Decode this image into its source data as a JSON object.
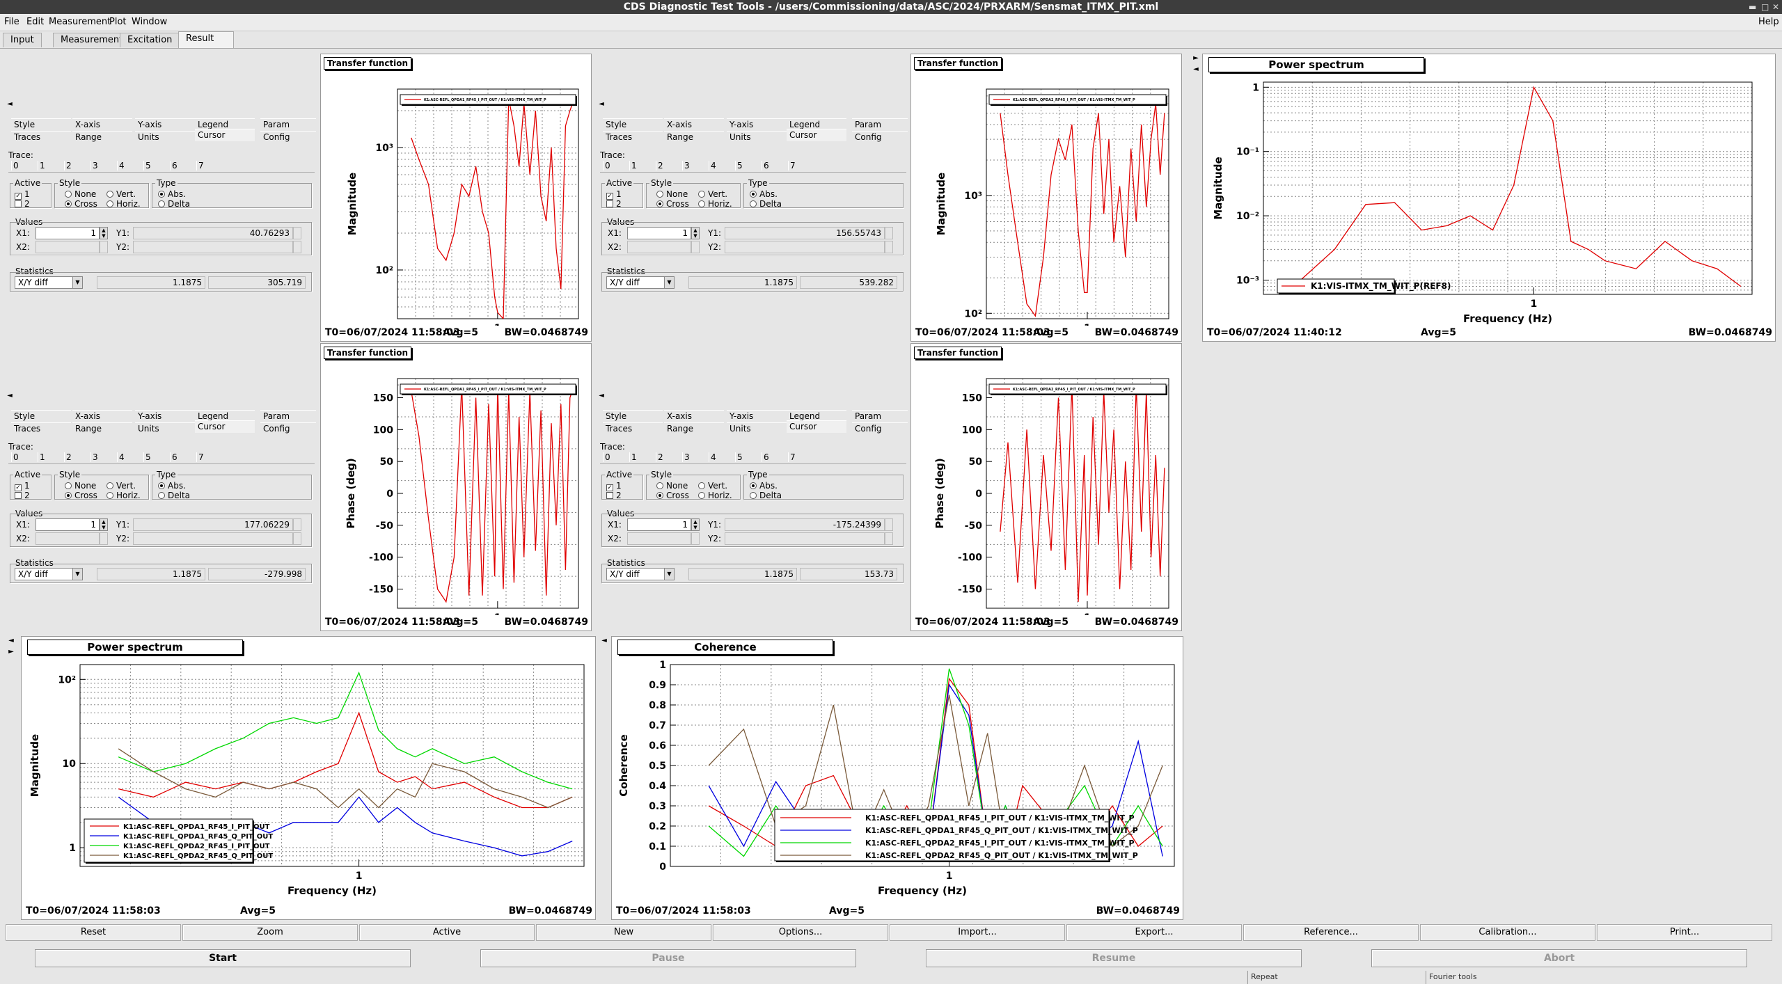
{
  "window": {
    "title": "CDS Diagnostic Test Tools - /users/Commissioning/data/ASC/2024/PRXARM/Sensmat_ITMX_PIT.xml",
    "help": "Help"
  },
  "menu": [
    "File",
    "Edit",
    "Measurement",
    "Plot",
    "Window"
  ],
  "tabs": [
    "Input",
    "Measurement",
    "Excitation",
    "Result"
  ],
  "options": {
    "row1": [
      "Style",
      "X-axis",
      "Y-axis",
      "Legend",
      "Param"
    ],
    "row2": [
      "Traces",
      "Range",
      "Units",
      "Cursor",
      "Config"
    ],
    "trace_label": "Trace:",
    "trace_nums": [
      "0",
      "1",
      "2",
      "3",
      "4",
      "5",
      "6",
      "7"
    ],
    "active_label": "Active",
    "style_label": "Style",
    "type_label": "Type",
    "none": "None",
    "cross": "Cross",
    "vert": "Vert.",
    "horiz": "Horiz.",
    "abs": "Abs.",
    "delta": "Delta",
    "values_label": "Values",
    "x1": "X1:",
    "y1": "Y1:",
    "x2": "X2:",
    "y2": "Y2:",
    "stats_label": "Statistics",
    "one": "1",
    "two": "2"
  },
  "controls": [
    {
      "x1": "1",
      "y1": "40.76293",
      "stat": "X/Y diff",
      "v1": "1.1875",
      "v2": "305.719"
    },
    {
      "x1": "1",
      "y1": "156.55743",
      "stat": "X/Y diff",
      "v1": "1.1875",
      "v2": "539.282"
    },
    {
      "x1": "1",
      "y1": "177.06229",
      "stat": "X/Y diff",
      "v1": "1.1875",
      "v2": "-279.998"
    },
    {
      "x1": "1",
      "y1": "-175.24399",
      "stat": "X/Y diff",
      "v1": "1.1875",
      "v2": "153.73"
    }
  ],
  "panels": [
    {
      "title": "Transfer function",
      "xlabel": "Frequency (Hz)",
      "ylabel": "Magnitude",
      "legend": "K1:ASC-REFL_QPDA1_RF45_I_PIT_OUT / K1:VIS-ITMX_TM_WIT_P",
      "t0": "T0=06/07/2024 11:58:03",
      "avg": "Avg=5",
      "bw": "BW=0.0468749",
      "ticks": [
        "10³",
        "10²"
      ],
      "xtick": "1"
    },
    {
      "title": "Transfer function",
      "xlabel": "Frequency (Hz)",
      "ylabel": "Magnitude",
      "legend": "K1:ASC-REFL_QPDA2_RF45_I_PIT_OUT / K1:VIS-ITMX_TM_WIT_P",
      "t0": "T0=06/07/2024 11:58:03",
      "avg": "Avg=5",
      "bw": "BW=0.0468749",
      "ticks": [
        "10³",
        "10²"
      ],
      "xtick": "1"
    },
    {
      "title": "Power spectrum",
      "xlabel": "Frequency (Hz)",
      "ylabel": "Magnitude",
      "legend": "K1:VIS-ITMX_TM_WIT_P(REF8)",
      "t0": "T0=06/07/2024 11:40:12",
      "avg": "Avg=5",
      "bw": "BW=0.0468749",
      "ticks": [
        "1",
        "10⁻¹",
        "10⁻²",
        "10⁻³"
      ],
      "xtick": "1"
    },
    {
      "title": "Transfer function",
      "xlabel": "Frequency (Hz)",
      "ylabel": "Phase (deg)",
      "legend": "K1:ASC-REFL_QPDA1_RF45_I_PIT_OUT / K1:VIS-ITMX_TM_WIT_P",
      "t0": "T0=06/07/2024 11:58:03",
      "avg": "Avg=5",
      "bw": "BW=0.0468749",
      "ticks": [
        "150",
        "100",
        "50",
        "0",
        "-50",
        "-100",
        "-150"
      ],
      "xtick": "1"
    },
    {
      "title": "Transfer function",
      "xlabel": "Frequency (Hz)",
      "ylabel": "Phase (deg)",
      "legend": "K1:ASC-REFL_QPDA2_RF45_I_PIT_OUT / K1:VIS-ITMX_TM_WIT_P",
      "t0": "T0=06/07/2024 11:58:03",
      "avg": "Avg=5",
      "bw": "BW=0.0468749",
      "ticks": [
        "150",
        "100",
        "50",
        "0",
        "-50",
        "-100",
        "-150"
      ],
      "xtick": "1"
    },
    {
      "title": "Power spectrum",
      "xlabel": "Frequency (Hz)",
      "ylabel": "Magnitude",
      "legend": "",
      "t0": "T0=06/07/2024 11:58:03",
      "avg": "Avg=5",
      "bw": "BW=0.0468749",
      "ticks": [
        "10²",
        "10",
        "1"
      ],
      "xtick": "1"
    },
    {
      "title": "Coherence",
      "xlabel": "Frequency (Hz)",
      "ylabel": "Coherence",
      "legend": "",
      "t0": "T0=06/07/2024 11:58:03",
      "avg": "Avg=5",
      "bw": "BW=0.0468749",
      "ticks": [
        "1",
        "0.9",
        "0.8",
        "0.7",
        "0.6",
        "0.5",
        "0.4",
        "0.3",
        "0.2",
        "0.1",
        "0"
      ],
      "xtick": "1"
    }
  ],
  "ps_legend": [
    "K1:ASC-REFL_QPDA1_RF45_I_PIT_OUT",
    "K1:ASC-REFL_QPDA1_RF45_Q_PIT_OUT",
    "K1:ASC-REFL_QPDA2_RF45_I_PIT_OUT",
    "K1:ASC-REFL_QPDA2_RF45_Q_PIT_OUT"
  ],
  "coh_legend": [
    "K1:ASC-REFL_QPDA1_RF45_I_PIT_OUT / K1:VIS-ITMX_TM_WIT_P",
    "K1:ASC-REFL_QPDA1_RF45_Q_PIT_OUT / K1:VIS-ITMX_TM_WIT_P",
    "K1:ASC-REFL_QPDA2_RF45_I_PIT_OUT / K1:VIS-ITMX_TM_WIT_P",
    "K1:ASC-REFL_QPDA2_RF45_Q_PIT_OUT / K1:VIS-ITMX_TM_WIT_P"
  ],
  "series_colors": {
    "s1": "#e00000",
    "s2": "#0000e0",
    "s3": "#00d800",
    "s4": "#7a5a3a"
  },
  "chart_data": [
    {
      "type": "line",
      "title": "Transfer function",
      "xlabel": "Frequency (Hz)",
      "ylabel": "Magnitude",
      "log_y": true,
      "ylim": [
        40,
        3000
      ],
      "x": [
        0.55,
        0.58,
        0.62,
        0.66,
        0.7,
        0.74,
        0.78,
        0.82,
        0.86,
        0.9,
        0.94,
        0.98,
        1.0,
        1.04,
        1.08,
        1.12,
        1.16,
        1.2,
        1.25,
        1.3,
        1.35,
        1.4,
        1.45,
        1.5,
        1.55,
        1.6,
        1.65,
        1.7
      ],
      "series": [
        {
          "name": "K1:ASC-REFL_QPDA1_RF45_I_PIT_OUT / K1:VIS-ITMX_TM_WIT_P",
          "values": [
            1200,
            800,
            500,
            150,
            120,
            200,
            500,
            400,
            700,
            300,
            200,
            60,
            45,
            40,
            2500,
            1500,
            700,
            2300,
            600,
            2000,
            400,
            250,
            1000,
            150,
            70,
            1500,
            2000,
            2500
          ]
        }
      ]
    },
    {
      "type": "line",
      "title": "Transfer function",
      "xlabel": "Frequency (Hz)",
      "ylabel": "Magnitude",
      "log_y": true,
      "ylim": [
        90,
        8000
      ],
      "x": [
        0.55,
        0.58,
        0.62,
        0.66,
        0.7,
        0.74,
        0.78,
        0.82,
        0.86,
        0.9,
        0.94,
        0.98,
        1.0,
        1.04,
        1.08,
        1.12,
        1.16,
        1.2,
        1.25,
        1.3,
        1.35,
        1.4,
        1.45,
        1.5,
        1.55,
        1.6,
        1.65,
        1.7
      ],
      "series": [
        {
          "name": "K1:ASC-REFL_QPDA2_RF45_I_PIT_OUT / K1:VIS-ITMX_TM_WIT_P",
          "values": [
            5000,
            1500,
            400,
            120,
            95,
            300,
            1500,
            3000,
            2000,
            4000,
            500,
            150,
            150,
            2500,
            5000,
            700,
            3000,
            400,
            1200,
            300,
            2500,
            600,
            4000,
            800,
            3000,
            6000,
            1500,
            5000
          ]
        }
      ]
    },
    {
      "type": "line",
      "title": "Power spectrum",
      "xlabel": "Frequency (Hz)",
      "ylabel": "Magnitude",
      "log_y": true,
      "ylim": [
        0.0006,
        1.2
      ],
      "x": [
        0.55,
        0.6,
        0.65,
        0.7,
        0.75,
        0.8,
        0.85,
        0.9,
        0.95,
        1.0,
        1.05,
        1.1,
        1.15,
        1.2,
        1.3,
        1.4,
        1.5,
        1.6,
        1.7
      ],
      "series": [
        {
          "name": "K1:VIS-ITMX_TM_WIT_P(REF8)",
          "values": [
            0.001,
            0.003,
            0.015,
            0.016,
            0.006,
            0.007,
            0.01,
            0.006,
            0.03,
            1.0,
            0.3,
            0.004,
            0.003,
            0.002,
            0.0015,
            0.004,
            0.002,
            0.0015,
            0.0008
          ]
        }
      ]
    },
    {
      "type": "line",
      "title": "Transfer function",
      "xlabel": "Frequency (Hz)",
      "ylabel": "Phase (deg)",
      "ylim": [
        -180,
        180
      ],
      "x": [
        0.55,
        0.58,
        0.62,
        0.66,
        0.7,
        0.74,
        0.78,
        0.82,
        0.86,
        0.9,
        0.94,
        0.98,
        1.0,
        1.04,
        1.08,
        1.12,
        1.16,
        1.2,
        1.25,
        1.3,
        1.35,
        1.4,
        1.45,
        1.5,
        1.55,
        1.6,
        1.65,
        1.7
      ],
      "series": [
        {
          "name": "K1:ASC-REFL_QPDA1_RF45_I_PIT_OUT / K1:VIS-ITMX_TM_WIT_P",
          "values": [
            160,
            90,
            -40,
            -150,
            -170,
            -100,
            170,
            -160,
            150,
            -160,
            140,
            -130,
            170,
            -150,
            160,
            -140,
            120,
            -100,
            160,
            -90,
            130,
            -160,
            110,
            -50,
            140,
            -120,
            150,
            170
          ]
        }
      ]
    },
    {
      "type": "line",
      "title": "Transfer function",
      "xlabel": "Frequency (Hz)",
      "ylabel": "Phase (deg)",
      "ylim": [
        -180,
        180
      ],
      "x": [
        0.55,
        0.58,
        0.62,
        0.66,
        0.7,
        0.74,
        0.78,
        0.82,
        0.86,
        0.9,
        0.94,
        0.98,
        1.0,
        1.04,
        1.08,
        1.12,
        1.16,
        1.2,
        1.25,
        1.3,
        1.35,
        1.4,
        1.45,
        1.5,
        1.55,
        1.6,
        1.65,
        1.7
      ],
      "series": [
        {
          "name": "K1:ASC-REFL_QPDA2_RF45_I_PIT_OUT / K1:VIS-ITMX_TM_WIT_P",
          "values": [
            -60,
            80,
            -140,
            100,
            -150,
            60,
            -90,
            150,
            -120,
            170,
            -170,
            60,
            -160,
            120,
            -80,
            160,
            -30,
            100,
            -150,
            50,
            -120,
            170,
            -60,
            160,
            -100,
            60,
            -130,
            40
          ]
        }
      ]
    },
    {
      "type": "line",
      "title": "Power spectrum",
      "xlabel": "Frequency (Hz)",
      "ylabel": "Magnitude",
      "log_y": true,
      "ylim": [
        0.6,
        150
      ],
      "x": [
        0.55,
        0.6,
        0.65,
        0.7,
        0.75,
        0.8,
        0.85,
        0.9,
        0.95,
        1.0,
        1.05,
        1.1,
        1.15,
        1.2,
        1.3,
        1.4,
        1.5,
        1.6,
        1.7
      ],
      "series": [
        {
          "name": "K1:ASC-REFL_QPDA1_RF45_I_PIT_OUT",
          "values": [
            5,
            4,
            6,
            5,
            6,
            5,
            6,
            8,
            10,
            40,
            8,
            6,
            7,
            5,
            6,
            4,
            3,
            3,
            4
          ]
        },
        {
          "name": "K1:ASC-REFL_QPDA1_RF45_Q_PIT_OUT",
          "values": [
            4,
            2,
            2,
            1.5,
            2,
            1.5,
            2,
            2,
            2,
            4,
            2,
            3,
            2,
            1.5,
            1.2,
            1,
            0.8,
            0.9,
            1.2
          ]
        },
        {
          "name": "K1:ASC-REFL_QPDA2_RF45_I_PIT_OUT",
          "values": [
            12,
            8,
            10,
            15,
            20,
            30,
            35,
            30,
            35,
            120,
            25,
            15,
            12,
            15,
            10,
            12,
            8,
            6,
            5
          ]
        },
        {
          "name": "K1:ASC-REFL_QPDA2_RF45_Q_PIT_OUT",
          "values": [
            15,
            8,
            5,
            4,
            6,
            5,
            6,
            5,
            3,
            5,
            3,
            5,
            4,
            10,
            8,
            5,
            4,
            3,
            4
          ]
        }
      ]
    },
    {
      "type": "line",
      "title": "Coherence",
      "xlabel": "Frequency (Hz)",
      "ylabel": "Coherence",
      "ylim": [
        0,
        1
      ],
      "x": [
        0.55,
        0.6,
        0.65,
        0.7,
        0.75,
        0.8,
        0.85,
        0.9,
        0.95,
        1.0,
        1.05,
        1.1,
        1.15,
        1.2,
        1.3,
        1.4,
        1.5,
        1.6,
        1.7
      ],
      "series": [
        {
          "name": "K1:ASC-REFL_QPDA1_RF45_I_PIT_OUT / K1:VIS-ITMX_TM_WIT_P",
          "values": [
            0.3,
            0.2,
            0.1,
            0.4,
            0.45,
            0.2,
            0.1,
            0.3,
            0.1,
            0.93,
            0.8,
            0.1,
            0.05,
            0.4,
            0.2,
            0.1,
            0.3,
            0.1,
            0.2
          ]
        },
        {
          "name": "K1:ASC-REFL_QPDA1_RF45_Q_PIT_OUT / K1:VIS-ITMX_TM_WIT_P",
          "values": [
            0.4,
            0.1,
            0.42,
            0.2,
            0.05,
            0.1,
            0.2,
            0.05,
            0.1,
            0.9,
            0.75,
            0.1,
            0.3,
            0.1,
            0.2,
            0.1,
            0.2,
            0.62,
            0.05
          ]
        },
        {
          "name": "K1:ASC-REFL_QPDA2_RF45_I_PIT_OUT / K1:VIS-ITMX_TM_WIT_P",
          "values": [
            0.2,
            0.05,
            0.3,
            0.1,
            0.2,
            0.1,
            0.3,
            0.1,
            0.2,
            0.98,
            0.7,
            0.1,
            0.3,
            0.1,
            0.2,
            0.4,
            0.1,
            0.3,
            0.1
          ]
        },
        {
          "name": "K1:ASC-REFL_QPDA2_RF45_Q_PIT_OUT / K1:VIS-ITMX_TM_WIT_P",
          "values": [
            0.5,
            0.68,
            0.2,
            0.3,
            0.8,
            0.1,
            0.38,
            0.1,
            0.3,
            0.85,
            0.3,
            0.66,
            0.1,
            0.2,
            0.1,
            0.5,
            0.1,
            0.2,
            0.5
          ]
        }
      ]
    }
  ],
  "toolbar": [
    "Reset",
    "Zoom",
    "Active",
    "New",
    "Options...",
    "Import...",
    "Export...",
    "Reference...",
    "Calibration...",
    "Print..."
  ],
  "actions": [
    "Start",
    "Pause",
    "Resume",
    "Abort"
  ],
  "status": [
    "Repeat",
    "Fourier tools"
  ]
}
